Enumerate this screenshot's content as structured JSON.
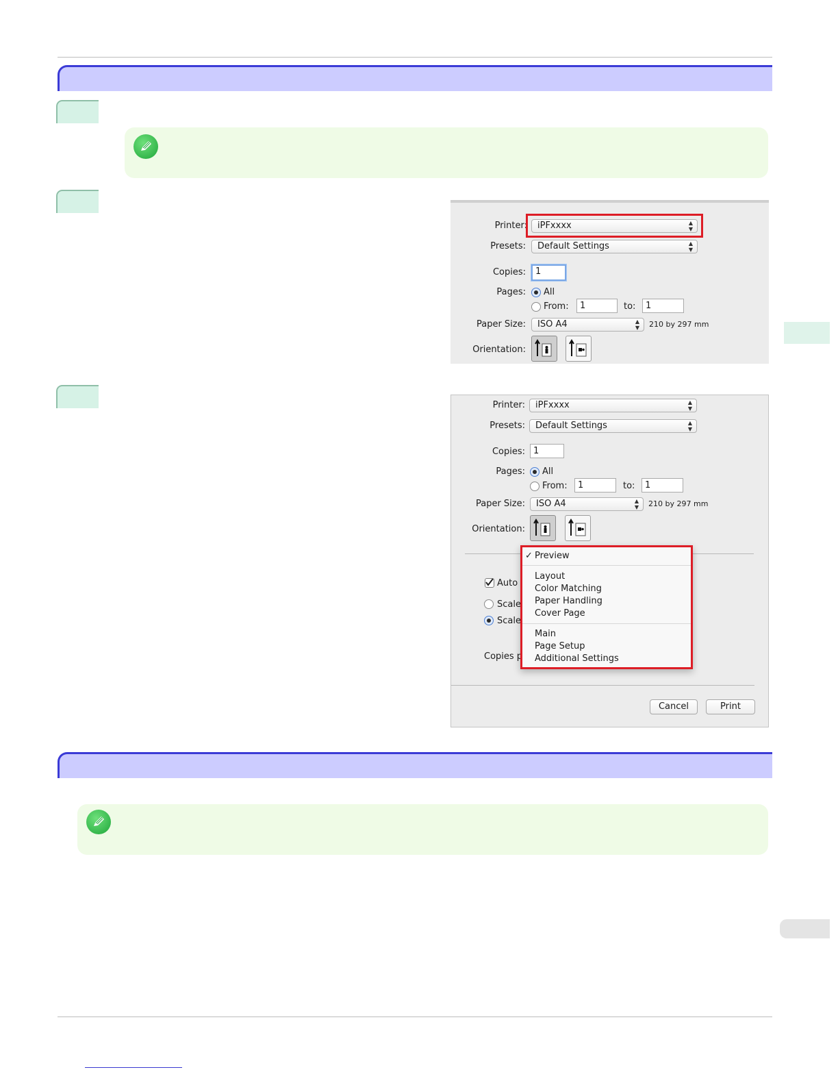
{
  "dialog_top": {
    "printer_label": "Printer:",
    "printer_value": "iPFxxxx",
    "presets_label": "Presets:",
    "presets_value": "Default Settings",
    "copies_label": "Copies:",
    "copies_value": "1",
    "pages_label": "Pages:",
    "pages_all": "All",
    "pages_from": "From:",
    "from_value": "1",
    "to_label": "to:",
    "to_value": "1",
    "paper_size_label": "Paper Size:",
    "paper_size_value": "ISO A4",
    "paper_size_dims": "210 by 297 mm",
    "orientation_label": "Orientation:"
  },
  "dialog_bottom": {
    "printer_label": "Printer:",
    "printer_value": "iPFxxxx",
    "presets_label": "Presets:",
    "presets_value": "Default Settings",
    "copies_label": "Copies:",
    "copies_value": "1",
    "pages_label": "Pages:",
    "pages_all": "All",
    "pages_from": "From:",
    "from_value": "1",
    "to_label": "to:",
    "to_value": "1",
    "paper_size_label": "Paper Size:",
    "paper_size_value": "ISO A4",
    "paper_size_dims": "210 by 297 mm",
    "orientation_label": "Orientation:",
    "auto_label": "Auto",
    "scale1_label": "Scale",
    "scale2_label": "Scale",
    "copies_per_label": "Copies p",
    "cancel_button": "Cancel",
    "print_button": "Print",
    "menu": {
      "selected_mark": "✓",
      "group1": [
        "Preview"
      ],
      "group2": [
        "Layout",
        "Color Matching",
        "Paper Handling",
        "Cover Page"
      ],
      "group3": [
        "Main",
        "Page Setup",
        "Additional Settings"
      ]
    }
  },
  "colors": {
    "section_bar": "#ccccff",
    "section_border": "#3b3bd6",
    "note_bg": "#effbe6",
    "highlight": "#dd1d26"
  }
}
